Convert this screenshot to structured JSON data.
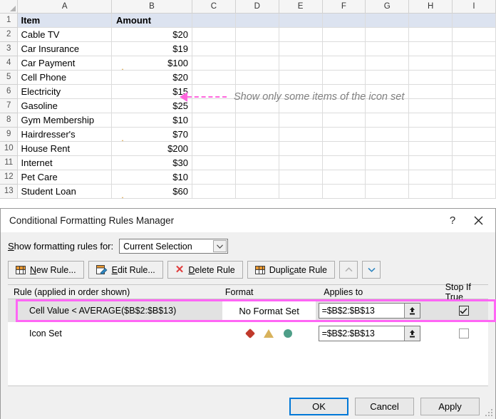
{
  "spreadsheet": {
    "column_letters": [
      "A",
      "B",
      "C",
      "D",
      "E",
      "F",
      "G",
      "H",
      "I"
    ],
    "headers": {
      "item": "Item",
      "amount": "Amount"
    },
    "rows": [
      {
        "num": "2",
        "item": "Cable TV",
        "amount": "$20",
        "icon": ""
      },
      {
        "num": "3",
        "item": "Car Insurance",
        "amount": "$19",
        "icon": ""
      },
      {
        "num": "4",
        "item": "Car Payment",
        "amount": "$100",
        "icon": "triangle-icon"
      },
      {
        "num": "5",
        "item": "Cell Phone",
        "amount": "$20",
        "icon": ""
      },
      {
        "num": "6",
        "item": "Electricity",
        "amount": "$15",
        "icon": ""
      },
      {
        "num": "7",
        "item": "Gasoline",
        "amount": "$25",
        "icon": ""
      },
      {
        "num": "8",
        "item": "Gym Membership",
        "amount": "$10",
        "icon": ""
      },
      {
        "num": "9",
        "item": "Hairdresser's",
        "amount": "$70",
        "icon": "triangle-icon"
      },
      {
        "num": "10",
        "item": "House Rent",
        "amount": "$200",
        "icon": "diamond-icon"
      },
      {
        "num": "11",
        "item": "Internet",
        "amount": "$30",
        "icon": ""
      },
      {
        "num": "12",
        "item": "Pet Care",
        "amount": "$10",
        "icon": ""
      },
      {
        "num": "13",
        "item": "Student Loan",
        "amount": "$60",
        "icon": "triangle-icon"
      }
    ]
  },
  "annotation": {
    "text": "Show only some items of the icon set",
    "color": "#ff66dd"
  },
  "dialog": {
    "title": "Conditional Formatting Rules Manager",
    "help_label": "?",
    "close_label": "✕",
    "show_for": {
      "label_prefix": "S",
      "label_rest": "how formatting rules for:",
      "selected": "Current Selection"
    },
    "toolbar": {
      "new_rule": {
        "pre": "",
        "accel": "N",
        "post": "ew Rule..."
      },
      "edit_rule": {
        "pre": "",
        "accel": "E",
        "post": "dit Rule..."
      },
      "delete_rule": {
        "pre": "",
        "accel": "D",
        "post": "elete Rule"
      },
      "duplicate_rule": {
        "pre": "Dupli",
        "accel": "c",
        "post": "ate Rule"
      },
      "move_up": "∧",
      "move_down": "∨"
    },
    "columns": {
      "rule": "Rule (applied in order shown)",
      "format": "Format",
      "applies_to": "Applies to",
      "stop_if_true": "Stop If True"
    },
    "rules": [
      {
        "name": "Cell Value < AVERAGE($B$2:$B$13)",
        "format_text": "No Format Set",
        "format_icons": [],
        "applies_to": "=$B$2:$B$13",
        "stop_if_true": true,
        "selected": true
      },
      {
        "name": "Icon Set",
        "format_text": "",
        "format_icons": [
          "diamond-icon",
          "triangle-icon",
          "circle-icon"
        ],
        "applies_to": "=$B$2:$B$13",
        "stop_if_true": false,
        "selected": false
      }
    ],
    "footer": {
      "ok": "OK",
      "cancel": "Cancel",
      "apply": "Apply"
    }
  },
  "colors": {
    "icon_diamond_sheet": "#d9482b",
    "icon_triangle_sheet": "#dfb263",
    "icon_diamond_dialog": "#c0392b",
    "icon_triangle_dialog": "#d8b25c",
    "icon_circle_dialog": "#4e9e88",
    "highlight_pink": "#ff66f5",
    "header_fill": "#dce3f0",
    "default_button_border": "#0078d7"
  }
}
